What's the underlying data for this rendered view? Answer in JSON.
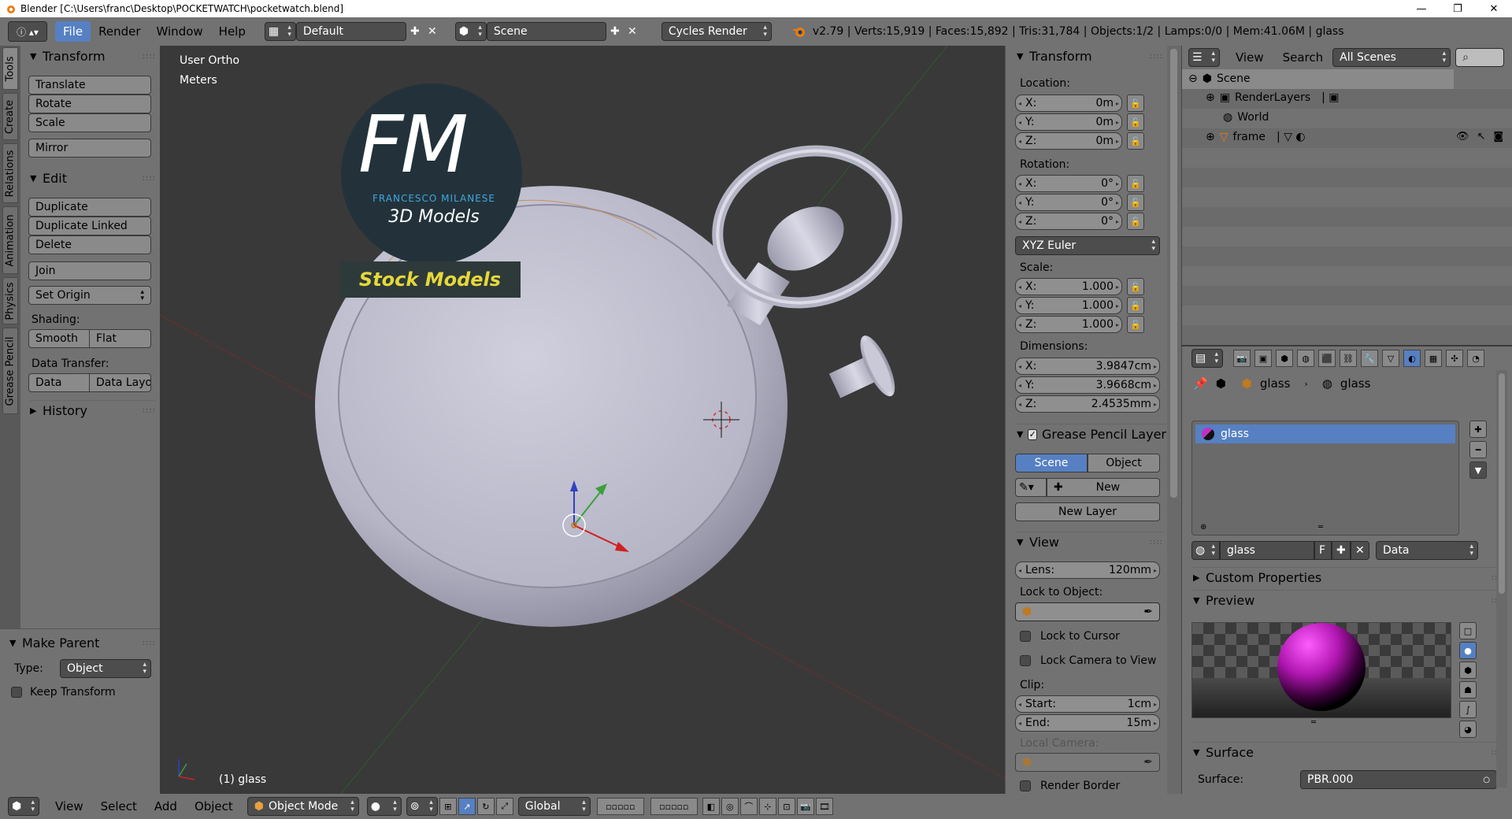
{
  "window": {
    "title": "Blender [C:\\Users\\franc\\Desktop\\POCKETWATCH\\pocketwatch.blend]",
    "min": "—",
    "max": "❐",
    "close": "✕"
  },
  "menubar": {
    "menus": [
      "File",
      "Render",
      "Window",
      "Help"
    ],
    "layout": "Default",
    "scene": "Scene",
    "engine": "Cycles Render",
    "stats": "v2.79 | Verts:15,919 | Faces:15,892 | Tris:31,784 | Objects:1/2 | Lamps:0/0 | Mem:41.06M | glass"
  },
  "vtabs": [
    "Tools",
    "Create",
    "Relations",
    "Animation",
    "Physics",
    "Grease Pencil"
  ],
  "tools": {
    "transform": "Transform",
    "translate": "Translate",
    "rotate": "Rotate",
    "scale": "Scale",
    "mirror": "Mirror",
    "edit": "Edit",
    "duplicate": "Duplicate",
    "duplicate_linked": "Duplicate Linked",
    "delete": "Delete",
    "join": "Join",
    "set_origin": "Set Origin",
    "shading": "Shading:",
    "smooth": "Smooth",
    "flat": "Flat",
    "data_transfer": "Data Transfer:",
    "data": "Data",
    "data_layo": "Data Layo",
    "history": "History"
  },
  "make_parent": {
    "title": "Make Parent",
    "type_label": "Type:",
    "type_value": "Object",
    "keep_transform": "Keep Transform"
  },
  "viewport": {
    "view_name": "User Ortho",
    "units": "Meters",
    "object_label": "(1) glass",
    "logo_fm": "FM",
    "logo_name": "FRANCESCO MILANESE",
    "logo_3d": "3D Models",
    "stock": "Stock Models"
  },
  "nprops": {
    "transform": "Transform",
    "location": "Location:",
    "loc": [
      {
        "axis": "X:",
        "val": "0m"
      },
      {
        "axis": "Y:",
        "val": "0m"
      },
      {
        "axis": "Z:",
        "val": "0m"
      }
    ],
    "rotation": "Rotation:",
    "rot": [
      {
        "axis": "X:",
        "val": "0°"
      },
      {
        "axis": "Y:",
        "val": "0°"
      },
      {
        "axis": "Z:",
        "val": "0°"
      }
    ],
    "rotation_mode": "XYZ Euler",
    "scale": "Scale:",
    "scl": [
      {
        "axis": "X:",
        "val": "1.000"
      },
      {
        "axis": "Y:",
        "val": "1.000"
      },
      {
        "axis": "Z:",
        "val": "1.000"
      }
    ],
    "dimensions": "Dimensions:",
    "dim": [
      {
        "axis": "X:",
        "val": "3.9847cm"
      },
      {
        "axis": "Y:",
        "val": "3.9668cm"
      },
      {
        "axis": "Z:",
        "val": "2.4535mm"
      }
    ],
    "gp_layer": "Grease Pencil Layer",
    "gp_scene": "Scene",
    "gp_object": "Object",
    "gp_new": "New",
    "gp_new_layer": "New Layer",
    "view": "View",
    "lens_label": "Lens:",
    "lens_value": "120mm",
    "lock_to_object": "Lock to Object:",
    "lock_to_cursor": "Lock to Cursor",
    "lock_camera": "Lock Camera to View",
    "clip": "Clip:",
    "clip_start_label": "Start:",
    "clip_start": "1cm",
    "clip_end_label": "End:",
    "clip_end": "15m",
    "local_camera": "Local Camera:",
    "render_border": "Render Border"
  },
  "outliner": {
    "view": "View",
    "search": "Search",
    "filter": "All Scenes",
    "items": [
      "Scene",
      "RenderLayers",
      "World",
      "frame"
    ]
  },
  "properties": {
    "breadcrumb_obj": "glass",
    "breadcrumb_mat": "glass",
    "slot": "glass",
    "mat_name": "glass",
    "fake_user": "F",
    "link": "Data",
    "custom_props": "Custom Properties",
    "preview": "Preview",
    "surface": "Surface",
    "surface_label": "Surface:",
    "surface_value": "PBR.000"
  },
  "bottombar": {
    "menus": [
      "View",
      "Select",
      "Add",
      "Object"
    ],
    "mode": "Object Mode",
    "orientation": "Global"
  },
  "colors": {
    "accent": "#5680c2",
    "viewport_bg": "#393939",
    "panel": "#727272",
    "logo_blue": "#3ea8e0",
    "stock_yellow": "#e5d83a"
  }
}
